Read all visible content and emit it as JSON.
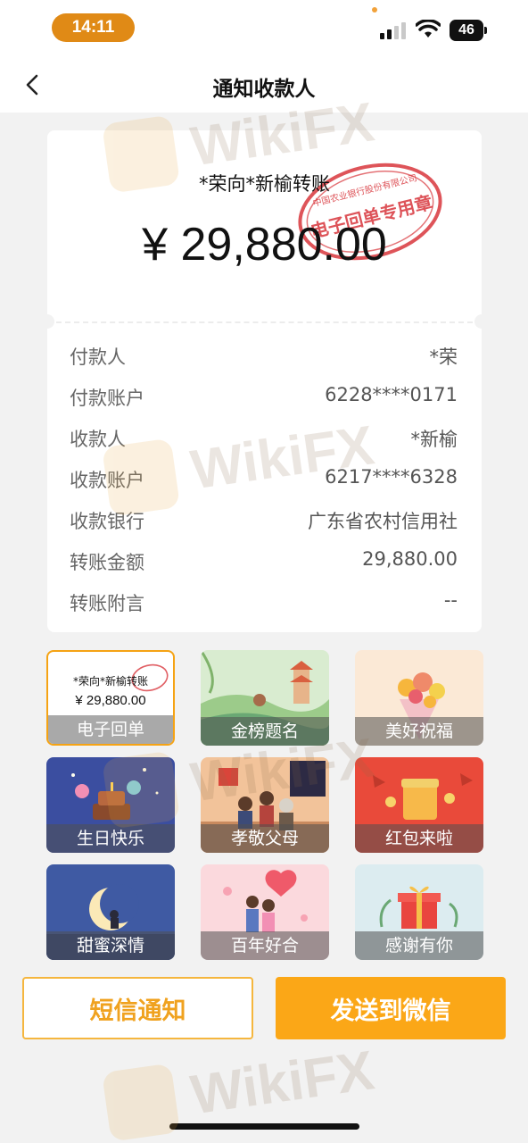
{
  "status_bar": {
    "time": "14:11",
    "battery": "46"
  },
  "nav": {
    "title": "通知收款人"
  },
  "receipt": {
    "title": "*荣向*新榆转账",
    "amount": "¥ 29,880.00",
    "details": [
      {
        "label": "付款人",
        "value": "*荣"
      },
      {
        "label": "付款账户",
        "value": "6228****0171"
      },
      {
        "label": "收款人",
        "value": "*新榆"
      },
      {
        "label": "收款账户",
        "value": "6217****6328"
      },
      {
        "label": "收款银行",
        "value": "广东省农村信用社"
      },
      {
        "label": "转账金额",
        "value": "29,880.00"
      },
      {
        "label": "转账附言",
        "value": "--"
      }
    ],
    "seal_text": "中国农业银行股份有限公司",
    "seal_center": "电子回单专用章"
  },
  "cards": [
    {
      "label": "电子回单",
      "selected": true,
      "mini_title": "*荣向*新榆转账",
      "mini_amount": "¥ 29,880.00"
    },
    {
      "label": "金榜题名"
    },
    {
      "label": "美好祝福"
    },
    {
      "label": "生日快乐"
    },
    {
      "label": "孝敬父母"
    },
    {
      "label": "红包来啦"
    },
    {
      "label": "甜蜜深情"
    },
    {
      "label": "百年好合"
    },
    {
      "label": "感谢有你"
    }
  ],
  "buttons": {
    "sms": "短信通知",
    "wechat": "发送到微信"
  },
  "watermark": "WikiFX",
  "colors": {
    "accent": "#fba717",
    "time_pill": "#e08a16",
    "seal": "#d8363c"
  }
}
